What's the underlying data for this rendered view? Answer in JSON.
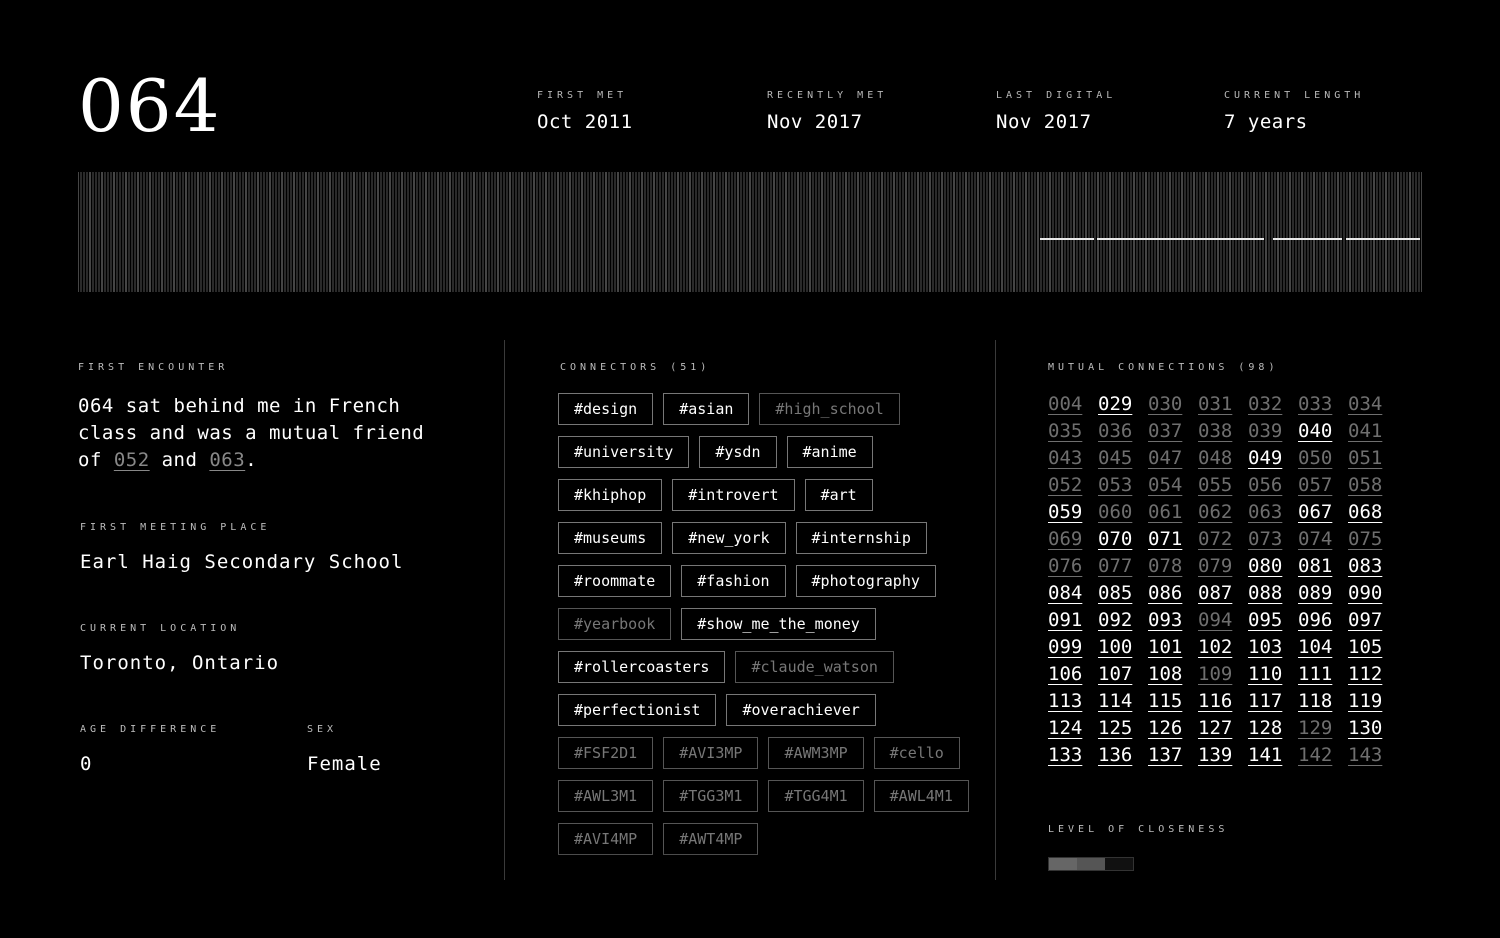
{
  "header": {
    "id": "064",
    "stats": [
      {
        "label": "FIRST MET",
        "value": "Oct 2011"
      },
      {
        "label": "RECENTLY MET",
        "value": "Nov 2017"
      },
      {
        "label": "LAST DIGITAL",
        "value": "Nov 2017"
      },
      {
        "label": "CURRENT LENGTH",
        "value": "7 years"
      }
    ]
  },
  "first_encounter": {
    "label": "FIRST ENCOUNTER",
    "text_before": "064 sat behind me in French class and was a mutual friend of ",
    "ref1": "052",
    "text_middle": " and ",
    "ref2": "063",
    "text_after": "."
  },
  "meeting_place": {
    "label": "FIRST MEETING PLACE",
    "value": "Earl Haig Secondary School"
  },
  "location": {
    "label": "CURRENT LOCATION",
    "value": "Toronto, Ontario"
  },
  "age_difference": {
    "label": "AGE DIFFERENCE",
    "value": "0"
  },
  "sex": {
    "label": "SEX",
    "value": "Female"
  },
  "connectors": {
    "label": "CONNECTORS (51)",
    "tags": [
      {
        "t": "#design",
        "dim": false
      },
      {
        "t": "#asian",
        "dim": false
      },
      {
        "t": "#high_school",
        "dim": true
      },
      {
        "t": "#university",
        "dim": false
      },
      {
        "t": "#ysdn",
        "dim": false
      },
      {
        "t": "#anime",
        "dim": false
      },
      {
        "t": "#khiphop",
        "dim": false
      },
      {
        "t": "#introvert",
        "dim": false
      },
      {
        "t": "#art",
        "dim": false
      },
      {
        "t": "#museums",
        "dim": false
      },
      {
        "t": "#new_york",
        "dim": false
      },
      {
        "t": "#internship",
        "dim": false
      },
      {
        "t": "#roommate",
        "dim": false
      },
      {
        "t": "#fashion",
        "dim": false
      },
      {
        "t": "#photography",
        "dim": false
      },
      {
        "t": "#yearbook",
        "dim": true
      },
      {
        "t": "#show_me_the_money",
        "dim": false
      },
      {
        "t": "#rollercoasters",
        "dim": false
      },
      {
        "t": "#claude_watson",
        "dim": true
      },
      {
        "t": "#perfectionist",
        "dim": false
      },
      {
        "t": "#overachiever",
        "dim": false
      },
      {
        "t": "#FSF2D1",
        "dim": true
      },
      {
        "t": "#AVI3MP",
        "dim": true
      },
      {
        "t": "#AWM3MP",
        "dim": true
      },
      {
        "t": "#cello",
        "dim": true
      },
      {
        "t": "#AWL3M1",
        "dim": true
      },
      {
        "t": "#TGG3M1",
        "dim": true
      },
      {
        "t": "#TGG4M1",
        "dim": true
      },
      {
        "t": "#AWL4M1",
        "dim": true
      },
      {
        "t": "#AVI4MP",
        "dim": true
      },
      {
        "t": "#AWT4MP",
        "dim": true
      }
    ]
  },
  "mutual": {
    "label": "MUTUAL CONNECTIONS (98)",
    "items": [
      {
        "n": "004",
        "a": false
      },
      {
        "n": "029",
        "a": true
      },
      {
        "n": "030",
        "a": false
      },
      {
        "n": "031",
        "a": false
      },
      {
        "n": "032",
        "a": false
      },
      {
        "n": "033",
        "a": false
      },
      {
        "n": "034",
        "a": false
      },
      {
        "n": "035",
        "a": false
      },
      {
        "n": "036",
        "a": false
      },
      {
        "n": "037",
        "a": false
      },
      {
        "n": "038",
        "a": false
      },
      {
        "n": "039",
        "a": false
      },
      {
        "n": "040",
        "a": true
      },
      {
        "n": "041",
        "a": false
      },
      {
        "n": "043",
        "a": false
      },
      {
        "n": "045",
        "a": false
      },
      {
        "n": "047",
        "a": false
      },
      {
        "n": "048",
        "a": false
      },
      {
        "n": "049",
        "a": true
      },
      {
        "n": "050",
        "a": false
      },
      {
        "n": "051",
        "a": false
      },
      {
        "n": "052",
        "a": false
      },
      {
        "n": "053",
        "a": false
      },
      {
        "n": "054",
        "a": false
      },
      {
        "n": "055",
        "a": false
      },
      {
        "n": "056",
        "a": false
      },
      {
        "n": "057",
        "a": false
      },
      {
        "n": "058",
        "a": false
      },
      {
        "n": "059",
        "a": true
      },
      {
        "n": "060",
        "a": false
      },
      {
        "n": "061",
        "a": false
      },
      {
        "n": "062",
        "a": false
      },
      {
        "n": "063",
        "a": false
      },
      {
        "n": "067",
        "a": true
      },
      {
        "n": "068",
        "a": true
      },
      {
        "n": "069",
        "a": false
      },
      {
        "n": "070",
        "a": true
      },
      {
        "n": "071",
        "a": true
      },
      {
        "n": "072",
        "a": false
      },
      {
        "n": "073",
        "a": false
      },
      {
        "n": "074",
        "a": false
      },
      {
        "n": "075",
        "a": false
      },
      {
        "n": "076",
        "a": false
      },
      {
        "n": "077",
        "a": false
      },
      {
        "n": "078",
        "a": false
      },
      {
        "n": "079",
        "a": false
      },
      {
        "n": "080",
        "a": true
      },
      {
        "n": "081",
        "a": true
      },
      {
        "n": "083",
        "a": true
      },
      {
        "n": "084",
        "a": true
      },
      {
        "n": "085",
        "a": true
      },
      {
        "n": "086",
        "a": true
      },
      {
        "n": "087",
        "a": true
      },
      {
        "n": "088",
        "a": true
      },
      {
        "n": "089",
        "a": true
      },
      {
        "n": "090",
        "a": true
      },
      {
        "n": "091",
        "a": true
      },
      {
        "n": "092",
        "a": true
      },
      {
        "n": "093",
        "a": true
      },
      {
        "n": "094",
        "a": false
      },
      {
        "n": "095",
        "a": true
      },
      {
        "n": "096",
        "a": true
      },
      {
        "n": "097",
        "a": true
      },
      {
        "n": "099",
        "a": true
      },
      {
        "n": "100",
        "a": true
      },
      {
        "n": "101",
        "a": true
      },
      {
        "n": "102",
        "a": true
      },
      {
        "n": "103",
        "a": true
      },
      {
        "n": "104",
        "a": true
      },
      {
        "n": "105",
        "a": true
      },
      {
        "n": "106",
        "a": true
      },
      {
        "n": "107",
        "a": true
      },
      {
        "n": "108",
        "a": true
      },
      {
        "n": "109",
        "a": false
      },
      {
        "n": "110",
        "a": true
      },
      {
        "n": "111",
        "a": true
      },
      {
        "n": "112",
        "a": true
      },
      {
        "n": "113",
        "a": true
      },
      {
        "n": "114",
        "a": true
      },
      {
        "n": "115",
        "a": true
      },
      {
        "n": "116",
        "a": true
      },
      {
        "n": "117",
        "a": true
      },
      {
        "n": "118",
        "a": true
      },
      {
        "n": "119",
        "a": true
      },
      {
        "n": "124",
        "a": true
      },
      {
        "n": "125",
        "a": true
      },
      {
        "n": "126",
        "a": true
      },
      {
        "n": "127",
        "a": true
      },
      {
        "n": "128",
        "a": true
      },
      {
        "n": "129",
        "a": false
      },
      {
        "n": "130",
        "a": true
      },
      {
        "n": "133",
        "a": true
      },
      {
        "n": "136",
        "a": true
      },
      {
        "n": "137",
        "a": true
      },
      {
        "n": "139",
        "a": true
      },
      {
        "n": "141",
        "a": true
      },
      {
        "n": "142",
        "a": false
      },
      {
        "n": "143",
        "a": false
      }
    ]
  },
  "closeness": {
    "label": "LEVEL OF CLOSENESS",
    "level": 2,
    "max": 3,
    "colors": [
      "#666666",
      "#555555",
      "#111111"
    ]
  }
}
